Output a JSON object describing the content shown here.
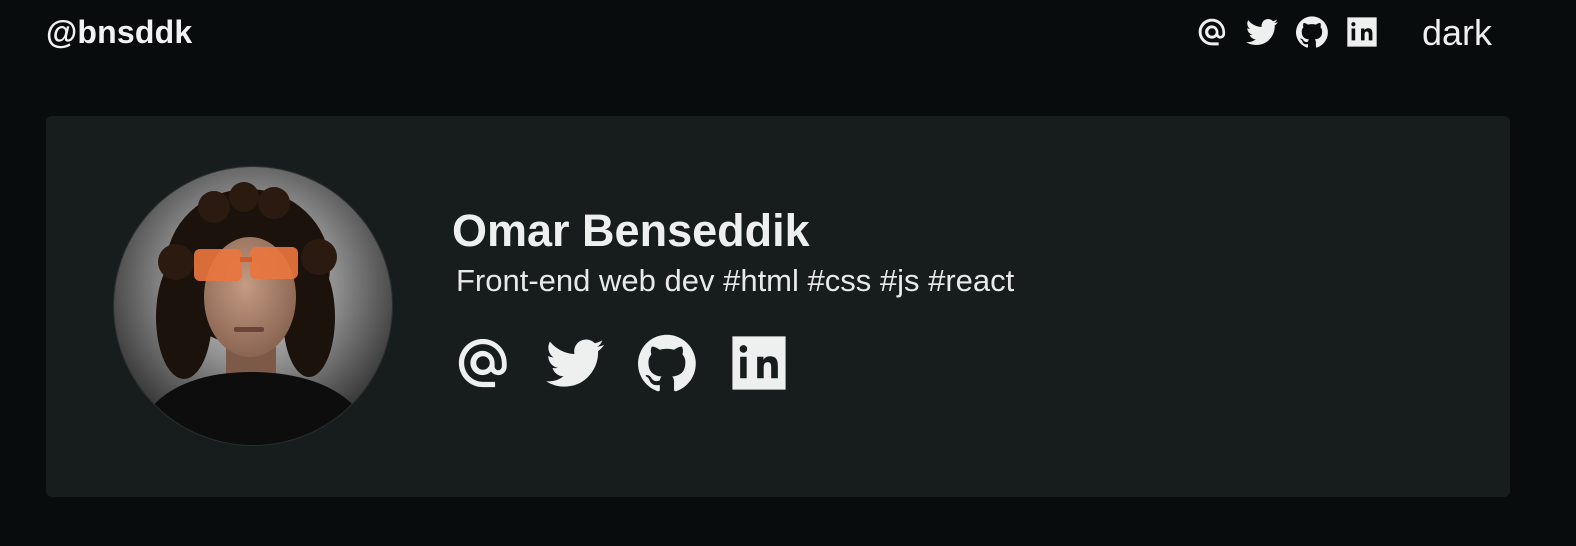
{
  "header": {
    "brand": "@bnsddk",
    "icons": [
      {
        "name": "at-sign-icon"
      },
      {
        "name": "twitter-icon"
      },
      {
        "name": "github-icon"
      },
      {
        "name": "linkedin-icon"
      }
    ],
    "theme_toggle_label": "dark"
  },
  "profile": {
    "name": "Omar Benseddik",
    "tagline": "Front-end web dev #html #css #js #react",
    "avatar_icon": "profile-photo",
    "links": [
      {
        "name": "at-sign-icon"
      },
      {
        "name": "twitter-icon"
      },
      {
        "name": "github-icon"
      },
      {
        "name": "linkedin-icon"
      }
    ]
  },
  "colors": {
    "background": "#090c0c",
    "card": "#171c1d",
    "text": "#eef0f0"
  }
}
